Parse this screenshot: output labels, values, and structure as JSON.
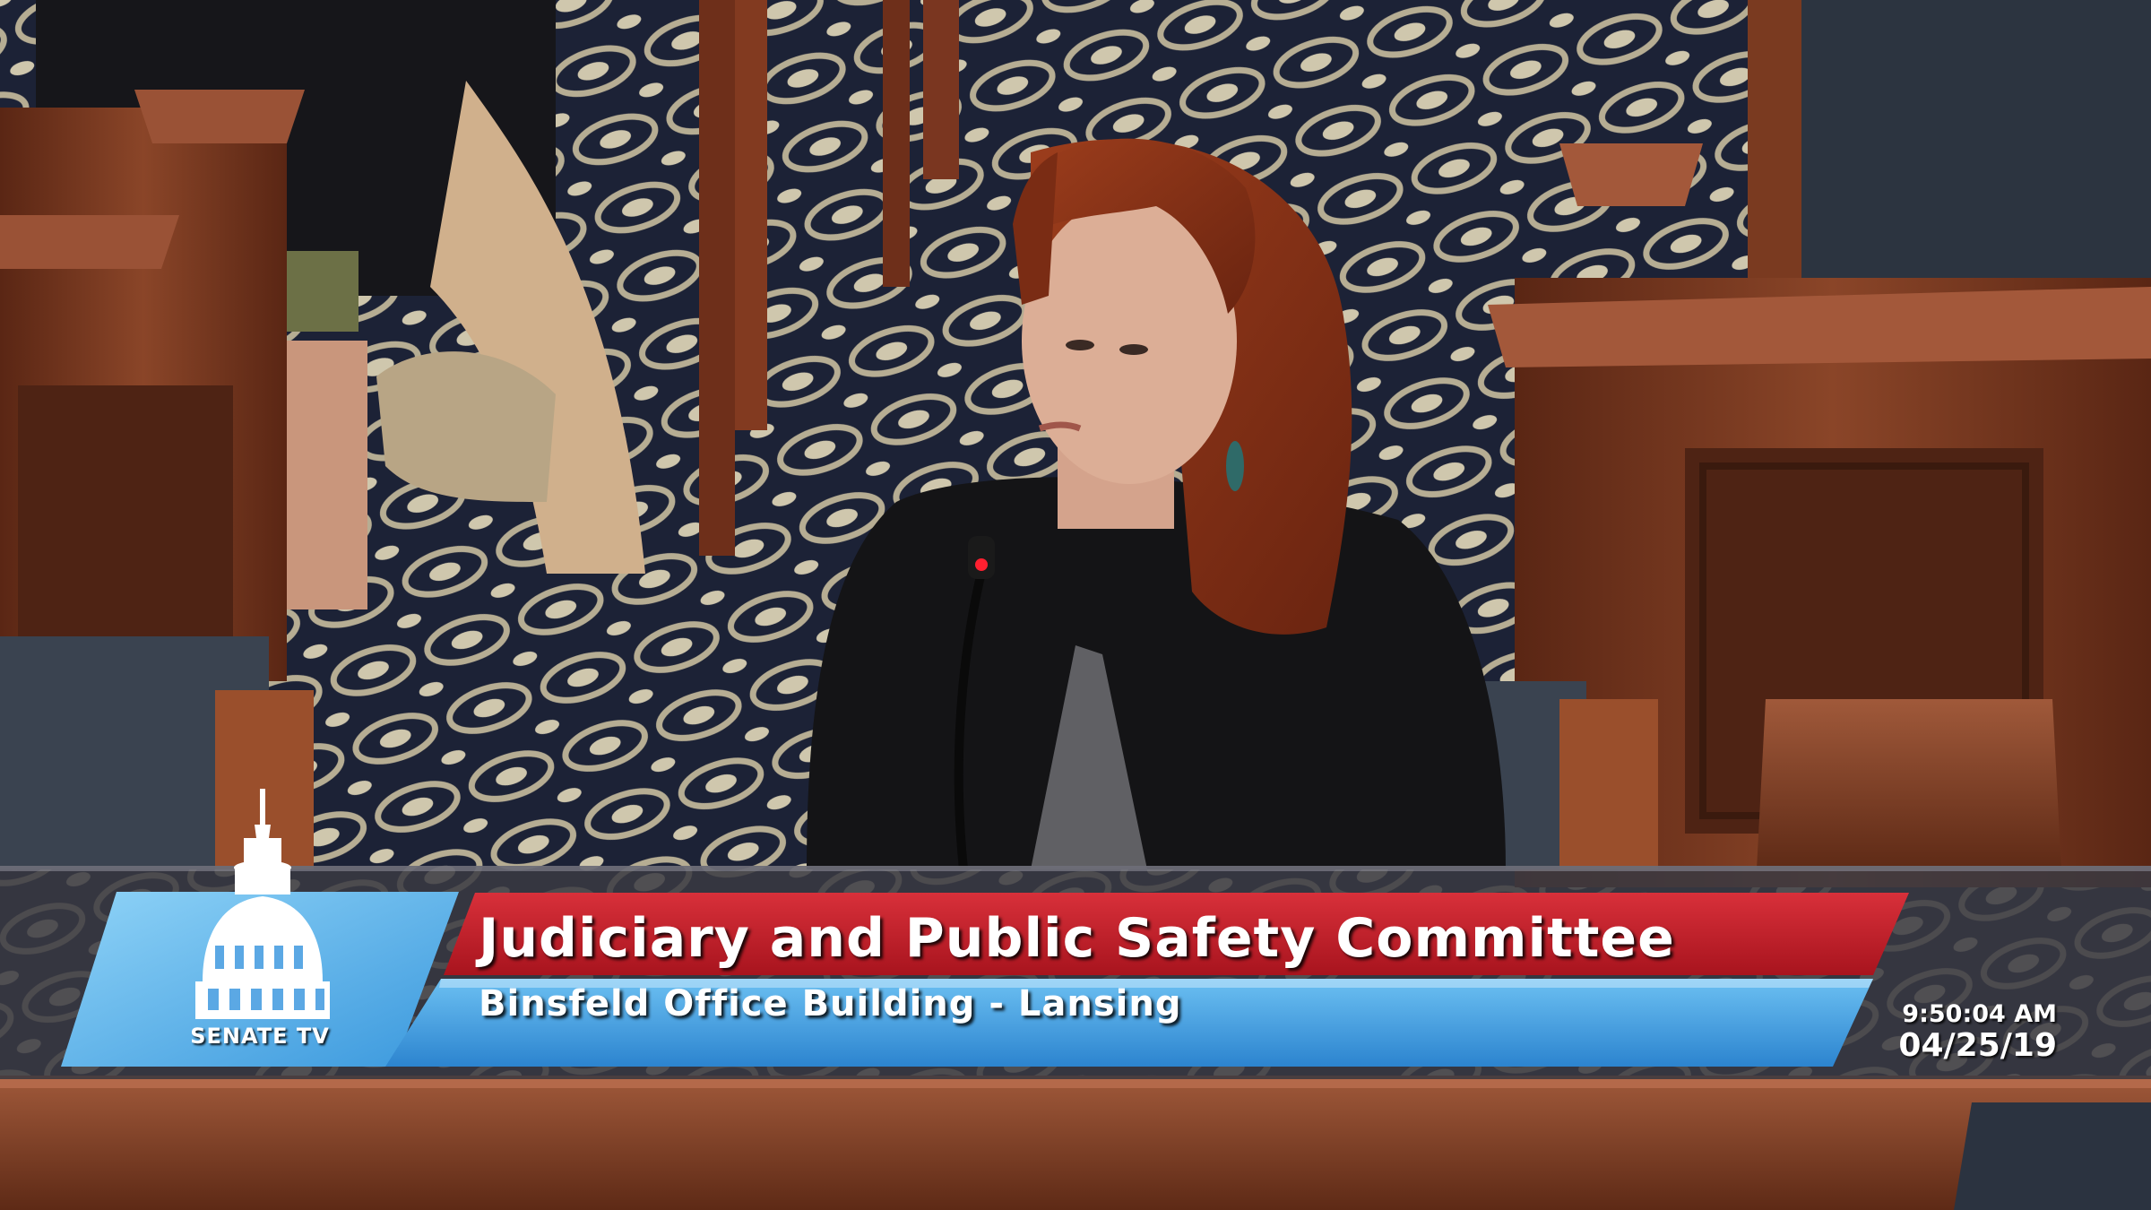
{
  "broadcast": {
    "logo_text": "SENATE TV",
    "title": "Judiciary and Public Safety Committee",
    "subtitle": "Binsfeld Office Building - Lansing",
    "time": "9:50:04 AM",
    "date": "04/25/19"
  },
  "colors": {
    "title_red": "#c0202a",
    "subtitle_blue": "#3f9be0",
    "logo_blue": "#5bb8ee",
    "hair_auburn": "#8a3418",
    "carpet_navy": "#1e2438",
    "wood": "#7a3d22"
  }
}
